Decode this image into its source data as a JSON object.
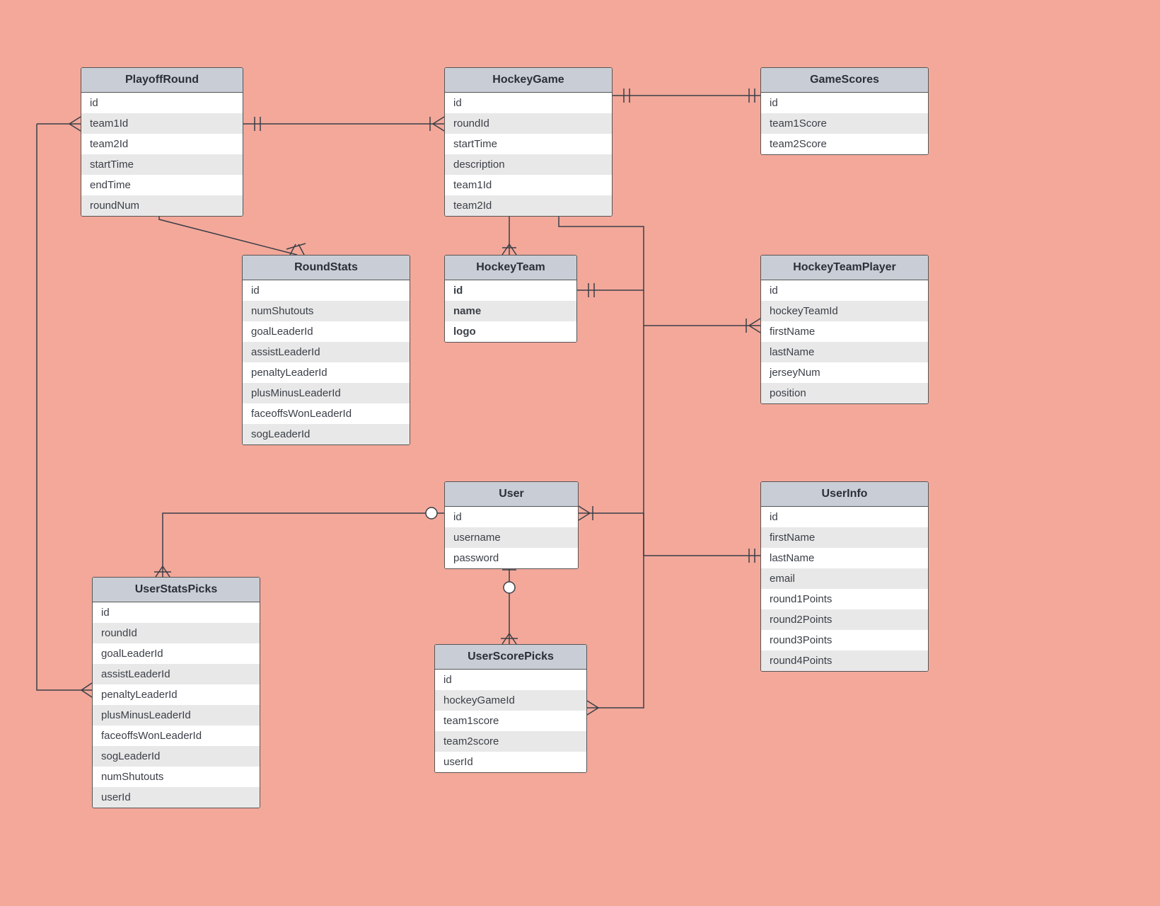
{
  "entities": {
    "playoffRound": {
      "title": "PlayoffRound",
      "fields": [
        "id",
        "team1Id",
        "team2Id",
        "startTime",
        "endTime",
        "roundNum"
      ]
    },
    "hockeyGame": {
      "title": "HockeyGame",
      "fields": [
        "id",
        "roundId",
        "startTime",
        "description",
        "team1Id",
        "team2Id"
      ]
    },
    "gameScores": {
      "title": "GameScores",
      "fields": [
        "id",
        "team1Score",
        "team2Score"
      ]
    },
    "roundStats": {
      "title": "RoundStats",
      "fields": [
        "id",
        "numShutouts",
        "goalLeaderId",
        "assistLeaderId",
        "penaltyLeaderId",
        "plusMinusLeaderId",
        "faceoffsWonLeaderId",
        "sogLeaderId"
      ]
    },
    "hockeyTeam": {
      "title": "HockeyTeam",
      "fields": [
        "id",
        "name",
        "logo"
      ],
      "bold": true
    },
    "hockeyTeamPlayer": {
      "title": "HockeyTeamPlayer",
      "fields": [
        "id",
        "hockeyTeamId",
        "firstName",
        "lastName",
        "jerseyNum",
        "position"
      ]
    },
    "user": {
      "title": "User",
      "fields": [
        "id",
        "username",
        "password"
      ]
    },
    "userInfo": {
      "title": "UserInfo",
      "fields": [
        "id",
        "firstName",
        "lastName",
        "email",
        "round1Points",
        "round2Points",
        "round3Points",
        "round4Points"
      ]
    },
    "userStatsPicks": {
      "title": "UserStatsPicks",
      "fields": [
        "id",
        "roundId",
        "goalLeaderId",
        "assistLeaderId",
        "penaltyLeaderId",
        "plusMinusLeaderId",
        "faceoffsWonLeaderId",
        "sogLeaderId",
        "numShutouts",
        "userId"
      ]
    },
    "userScorePicks": {
      "title": "UserScorePicks",
      "fields": [
        "id",
        "hockeyGameId",
        "team1score",
        "team2score",
        "userId"
      ]
    }
  }
}
